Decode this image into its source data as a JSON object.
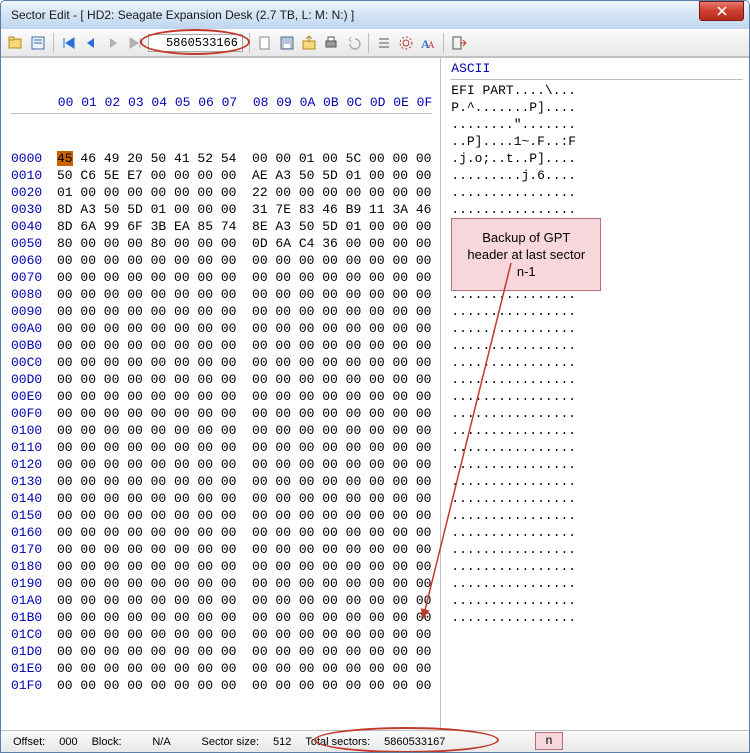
{
  "window": {
    "title": "Sector Edit - [ HD2: Seagate Expansion Desk (2.7 TB, L: M: N:) ]"
  },
  "toolbar": {
    "sector_value": "5860533166"
  },
  "hex": {
    "header_cols": "      00 01 02 03 04 05 06 07  08 09 0A 0B 0C 0D 0E 0F",
    "ascii_header": "ASCII",
    "rows": [
      {
        "off": "0000",
        "b0": "45",
        "bytes": " 46 49 20 50 41 52 54  00 00 01 00 5C 00 00 00",
        "asc": "EFI PART....\\..."
      },
      {
        "off": "0010",
        "b": "50 C6 5E E7 00 00 00 00  AE A3 50 5D 01 00 00 00",
        "asc": "P.^.......P]...."
      },
      {
        "off": "0020",
        "b": "01 00 00 00 00 00 00 00  22 00 00 00 00 00 00 00",
        "asc": "........\"......."
      },
      {
        "off": "0030",
        "b": "8D A3 50 5D 01 00 00 00  31 7E 83 46 B9 11 3A 46",
        "asc": "..P]....1~.F..:F"
      },
      {
        "off": "0040",
        "b": "8D 6A 99 6F 3B EA 85 74  8E A3 50 5D 01 00 00 00",
        "asc": ".j.o;..t..P]...."
      },
      {
        "off": "0050",
        "b": "80 00 00 00 80 00 00 00  0D 6A C4 36 00 00 00 00",
        "asc": ".........j.6...."
      },
      {
        "off": "0060",
        "b": "00 00 00 00 00 00 00 00  00 00 00 00 00 00 00 00",
        "asc": "................"
      },
      {
        "off": "0070",
        "b": "00 00 00 00 00 00 00 00  00 00 00 00 00 00 00 00",
        "asc": "................"
      },
      {
        "off": "0080",
        "b": "00 00 00 00 00 00 00 00  00 00 00 00 00 00 00 00",
        "asc": "................"
      },
      {
        "off": "0090",
        "b": "00 00 00 00 00 00 00 00  00 00 00 00 00 00 00 00",
        "asc": "................"
      },
      {
        "off": "00A0",
        "b": "00 00 00 00 00 00 00 00  00 00 00 00 00 00 00 00",
        "asc": "................"
      },
      {
        "off": "00B0",
        "b": "00 00 00 00 00 00 00 00  00 00 00 00 00 00 00 00",
        "asc": "................"
      },
      {
        "off": "00C0",
        "b": "00 00 00 00 00 00 00 00  00 00 00 00 00 00 00 00",
        "asc": "................"
      },
      {
        "off": "00D0",
        "b": "00 00 00 00 00 00 00 00  00 00 00 00 00 00 00 00",
        "asc": "................"
      },
      {
        "off": "00E0",
        "b": "00 00 00 00 00 00 00 00  00 00 00 00 00 00 00 00",
        "asc": "................"
      },
      {
        "off": "00F0",
        "b": "00 00 00 00 00 00 00 00  00 00 00 00 00 00 00 00",
        "asc": "................"
      },
      {
        "off": "0100",
        "b": "00 00 00 00 00 00 00 00  00 00 00 00 00 00 00 00",
        "asc": "................"
      },
      {
        "off": "0110",
        "b": "00 00 00 00 00 00 00 00  00 00 00 00 00 00 00 00",
        "asc": "................"
      },
      {
        "off": "0120",
        "b": "00 00 00 00 00 00 00 00  00 00 00 00 00 00 00 00",
        "asc": "................"
      },
      {
        "off": "0130",
        "b": "00 00 00 00 00 00 00 00  00 00 00 00 00 00 00 00",
        "asc": "................"
      },
      {
        "off": "0140",
        "b": "00 00 00 00 00 00 00 00  00 00 00 00 00 00 00 00",
        "asc": "................"
      },
      {
        "off": "0150",
        "b": "00 00 00 00 00 00 00 00  00 00 00 00 00 00 00 00",
        "asc": "................"
      },
      {
        "off": "0160",
        "b": "00 00 00 00 00 00 00 00  00 00 00 00 00 00 00 00",
        "asc": "................"
      },
      {
        "off": "0170",
        "b": "00 00 00 00 00 00 00 00  00 00 00 00 00 00 00 00",
        "asc": "................"
      },
      {
        "off": "0180",
        "b": "00 00 00 00 00 00 00 00  00 00 00 00 00 00 00 00",
        "asc": "................"
      },
      {
        "off": "0190",
        "b": "00 00 00 00 00 00 00 00  00 00 00 00 00 00 00 00",
        "asc": "................"
      },
      {
        "off": "01A0",
        "b": "00 00 00 00 00 00 00 00  00 00 00 00 00 00 00 00",
        "asc": "................"
      },
      {
        "off": "01B0",
        "b": "00 00 00 00 00 00 00 00  00 00 00 00 00 00 00 00",
        "asc": "................"
      },
      {
        "off": "01C0",
        "b": "00 00 00 00 00 00 00 00  00 00 00 00 00 00 00 00",
        "asc": "................"
      },
      {
        "off": "01D0",
        "b": "00 00 00 00 00 00 00 00  00 00 00 00 00 00 00 00",
        "asc": "................"
      },
      {
        "off": "01E0",
        "b": "00 00 00 00 00 00 00 00  00 00 00 00 00 00 00 00",
        "asc": "................"
      },
      {
        "off": "01F0",
        "b": "00 00 00 00 00 00 00 00  00 00 00 00 00 00 00 00",
        "asc": "................"
      }
    ]
  },
  "callout": {
    "text": "Backup of GPT header at last sector n-1"
  },
  "status": {
    "offset_label": "Offset:",
    "offset_val": "000",
    "block_label": "Block:",
    "block_val": "N/A",
    "sector_size_label": "Sector size:",
    "sector_size_val": "512",
    "total_sectors_label": "Total sectors:",
    "total_sectors_val": "5860533167",
    "n_label": "n"
  }
}
